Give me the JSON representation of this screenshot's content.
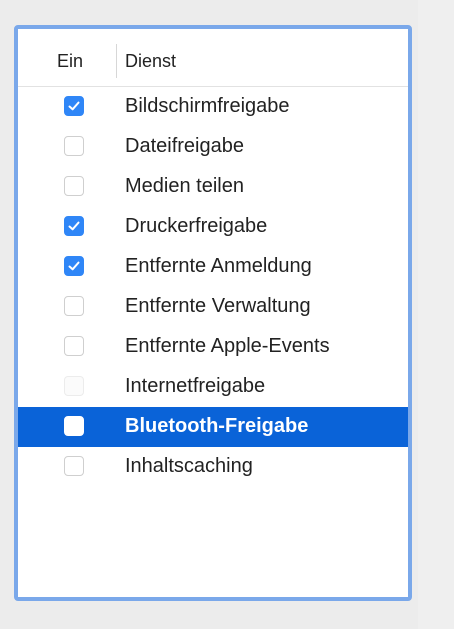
{
  "table": {
    "headers": {
      "ein": "Ein",
      "dienst": "Dienst"
    },
    "rows": [
      {
        "label": "Bildschirmfreigabe",
        "checked": true,
        "selected": false,
        "enabled": true
      },
      {
        "label": "Dateifreigabe",
        "checked": false,
        "selected": false,
        "enabled": true
      },
      {
        "label": "Medien teilen",
        "checked": false,
        "selected": false,
        "enabled": true
      },
      {
        "label": "Druckerfreigabe",
        "checked": true,
        "selected": false,
        "enabled": true
      },
      {
        "label": "Entfernte Anmeldung",
        "checked": true,
        "selected": false,
        "enabled": true
      },
      {
        "label": "Entfernte Verwaltung",
        "checked": false,
        "selected": false,
        "enabled": true
      },
      {
        "label": "Entfernte Apple-Events",
        "checked": false,
        "selected": false,
        "enabled": true
      },
      {
        "label": "Internetfreigabe",
        "checked": false,
        "selected": false,
        "enabled": false
      },
      {
        "label": "Bluetooth-Freigabe",
        "checked": false,
        "selected": true,
        "enabled": true
      },
      {
        "label": "Inhaltscaching",
        "checked": false,
        "selected": false,
        "enabled": true
      }
    ]
  },
  "colors": {
    "accent": "#2f86f7",
    "selection": "#0a63d8",
    "focus_ring": "#7aa8ea",
    "background": "#ececec"
  },
  "icons": {
    "checkbox_checked": "checkmark-icon"
  }
}
